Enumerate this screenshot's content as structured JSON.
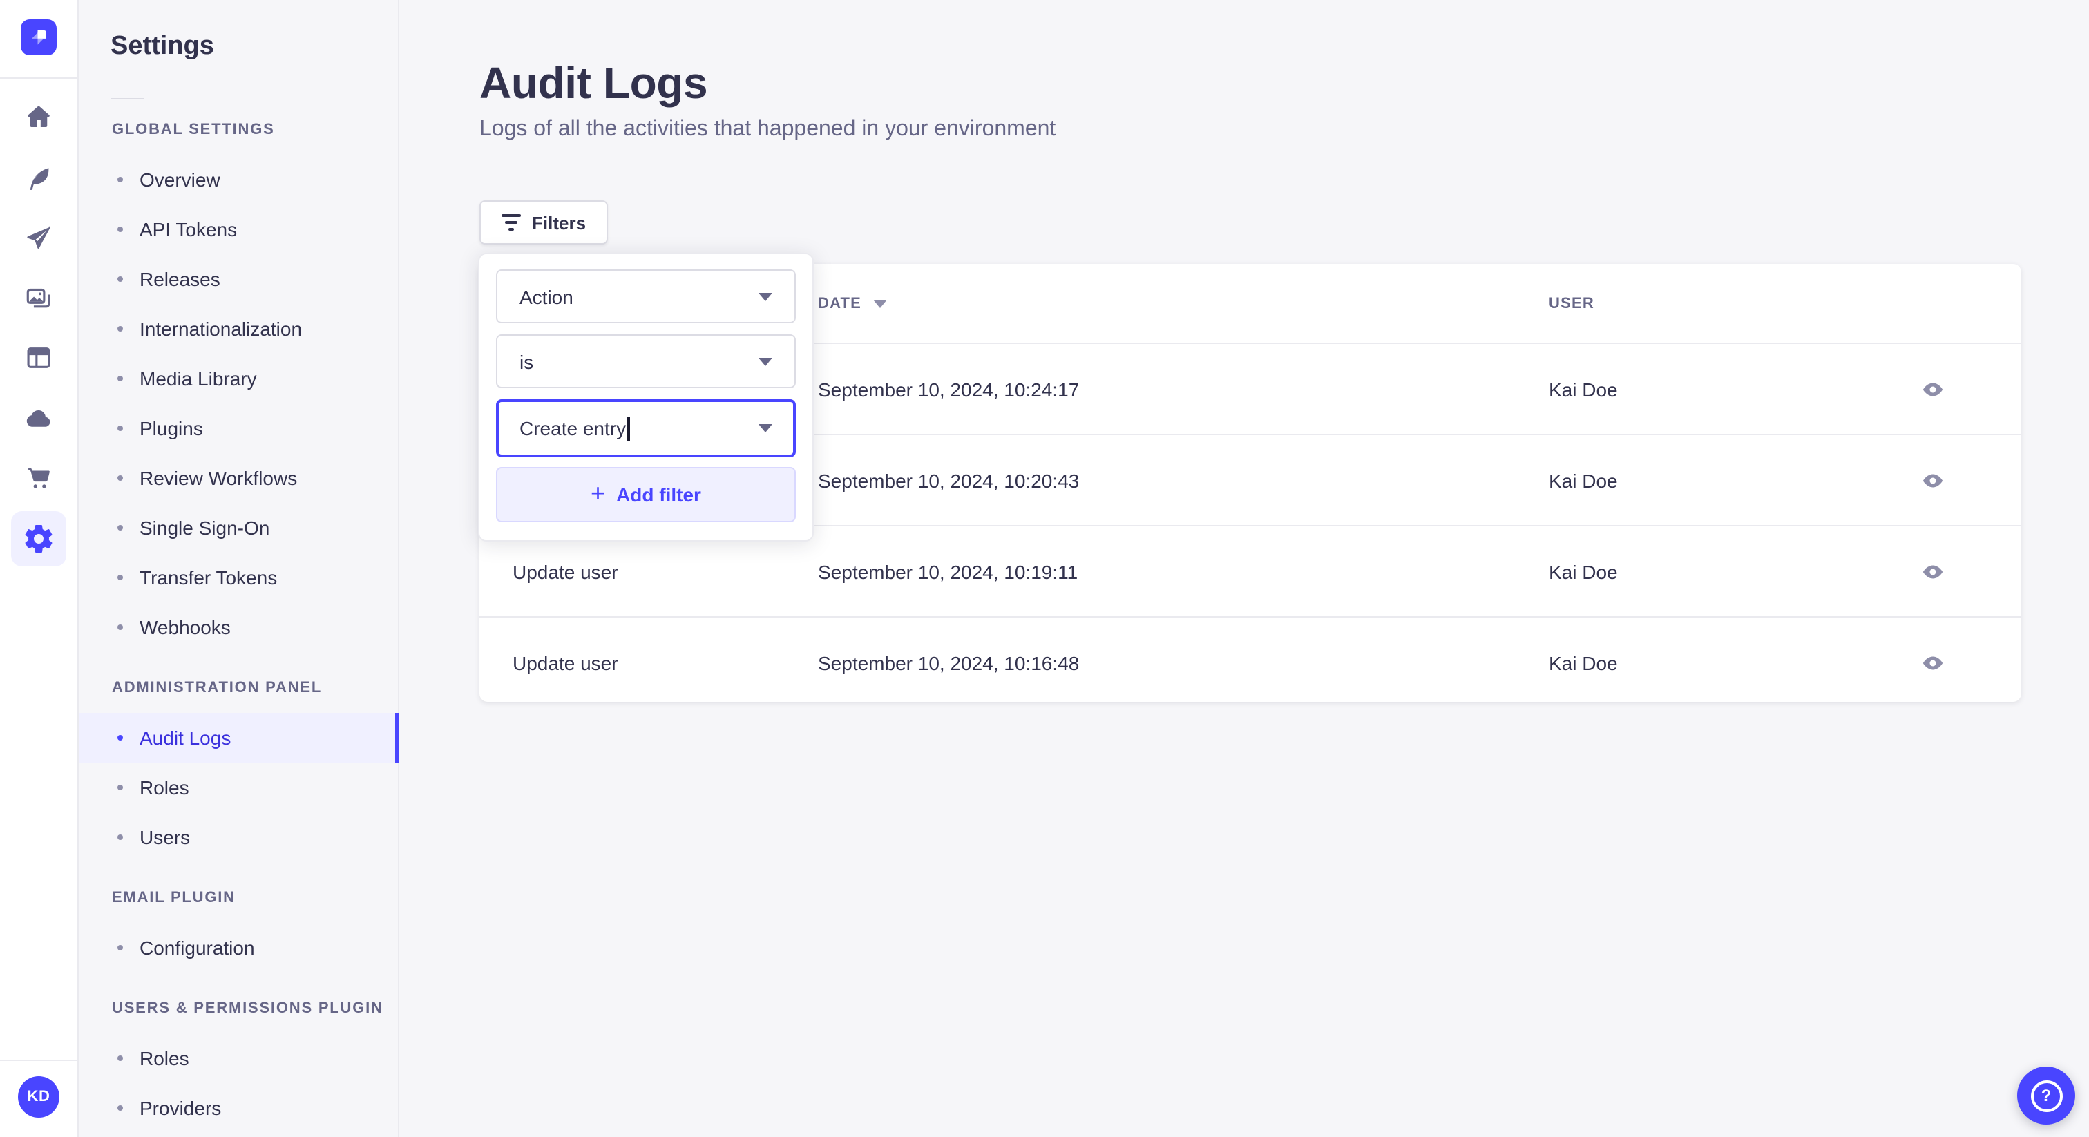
{
  "icon_rail": {
    "avatar_initials": "KD"
  },
  "settings_nav": {
    "title": "Settings",
    "sections": [
      {
        "label": "GLOBAL SETTINGS",
        "items": [
          "Overview",
          "API Tokens",
          "Releases",
          "Internationalization",
          "Media Library",
          "Plugins",
          "Review Workflows",
          "Single Sign-On",
          "Transfer Tokens",
          "Webhooks"
        ]
      },
      {
        "label": "ADMINISTRATION PANEL",
        "items": [
          "Audit Logs",
          "Roles",
          "Users"
        ],
        "active_item": "Audit Logs"
      },
      {
        "label": "EMAIL PLUGIN",
        "items": [
          "Configuration"
        ]
      },
      {
        "label": "USERS & PERMISSIONS PLUGIN",
        "items": [
          "Roles",
          "Providers"
        ]
      }
    ]
  },
  "main": {
    "title": "Audit Logs",
    "subtitle": "Logs of all the activities that happened in your environment",
    "filters_button_label": "Filters",
    "filter_popover": {
      "field_selected": "Action",
      "operator_selected": "is",
      "value_text": "Create entry",
      "add_filter_label": "Add filter"
    },
    "table": {
      "date_header": "DATE",
      "user_header": "USER",
      "rows": [
        {
          "action": "",
          "date": "September 10, 2024, 10:24:17",
          "user": "Kai Doe"
        },
        {
          "action": "",
          "date": "September 10, 2024, 10:20:43",
          "user": "Kai Doe"
        },
        {
          "action": "Update user",
          "date": "September 10, 2024, 10:19:11",
          "user": "Kai Doe"
        },
        {
          "action": "Update user",
          "date": "September 10, 2024, 10:16:48",
          "user": "Kai Doe"
        }
      ]
    },
    "help_label": "?"
  },
  "colors": {
    "primary": "#4945ff",
    "primary_light": "#f0f0ff",
    "primary_border": "#d9d8ff",
    "text": "#32324d",
    "text_muted": "#666687",
    "border": "#eaeaef",
    "background": "#f6f6f9"
  }
}
